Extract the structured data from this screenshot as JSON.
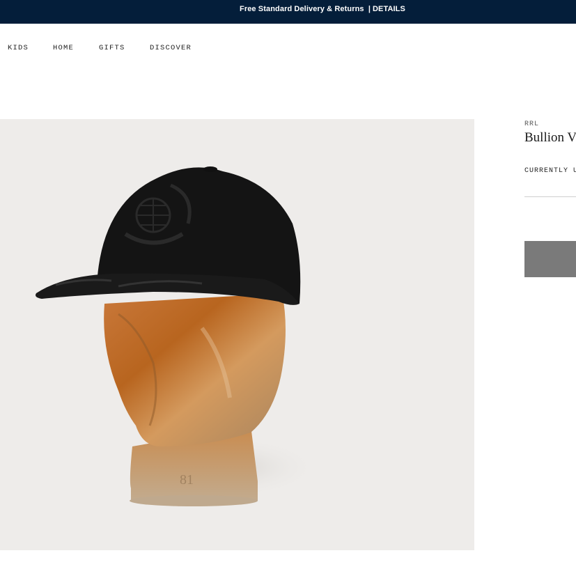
{
  "promo": {
    "text": "Free Standard Delivery & Returns",
    "separator": "|",
    "link": "DETAILS"
  },
  "nav": {
    "items": [
      "KIDS",
      "HOME",
      "GIFTS",
      "DISCOVER"
    ]
  },
  "product": {
    "brand": "RRL",
    "name": "Bullion V",
    "price_label": "CURRENTLY U",
    "image_alt": "Black baseball cap with embroidered crest on a wooden head form"
  },
  "colors": {
    "promo_bg": "#041e3a",
    "image_bg": "#eeecea",
    "button_bg": "#7a7a7a"
  }
}
